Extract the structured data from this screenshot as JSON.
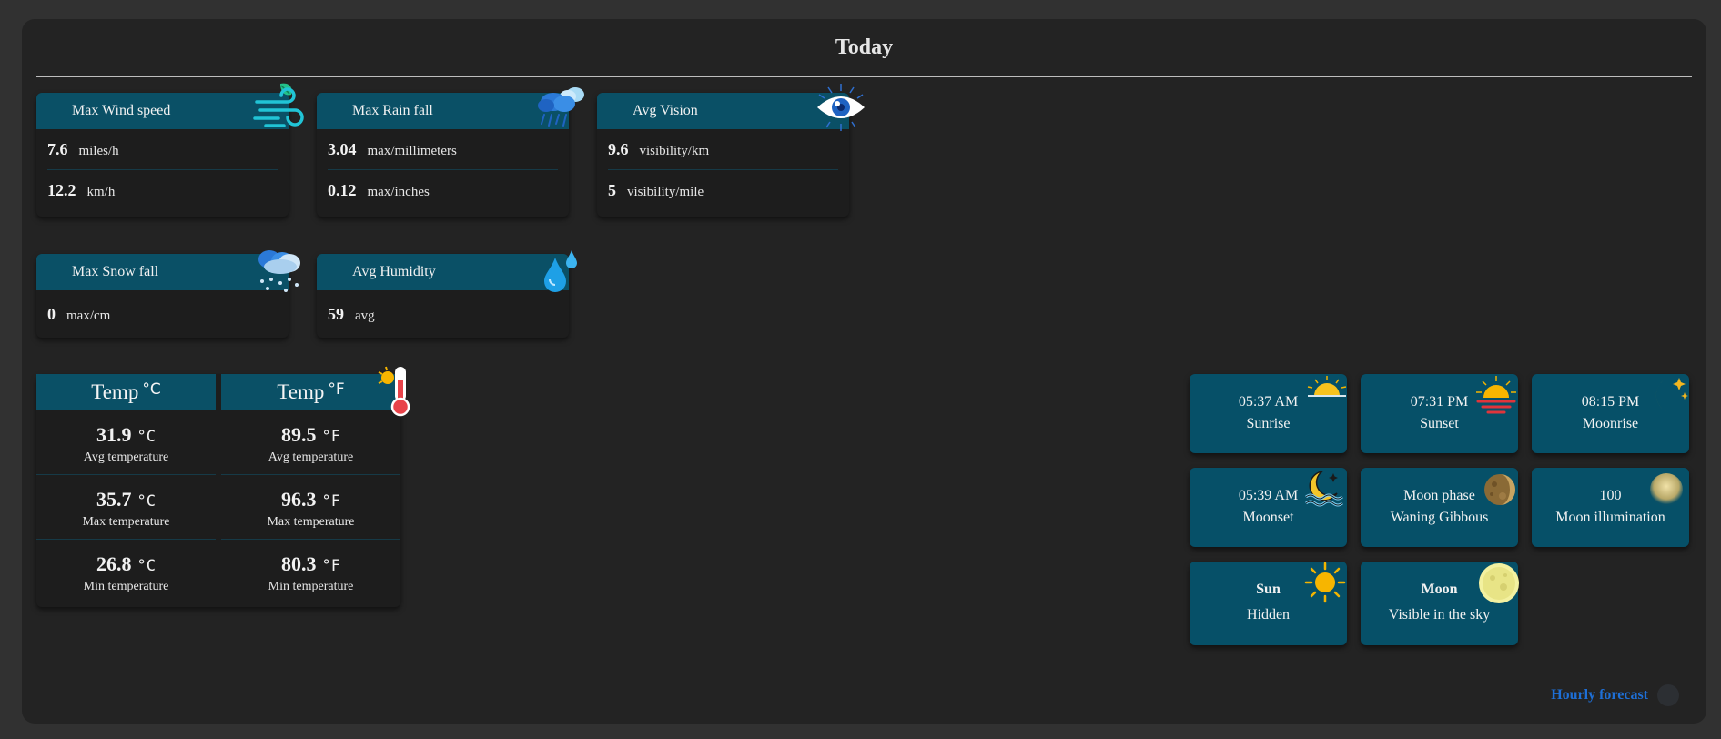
{
  "title": "Today",
  "wind": {
    "label": "Max Wind speed",
    "rows": [
      {
        "value": "7.6",
        "unit": "miles/h"
      },
      {
        "value": "12.2",
        "unit": "km/h"
      }
    ],
    "icon": "wind-icon"
  },
  "rain": {
    "label": "Max Rain fall",
    "rows": [
      {
        "value": "3.04",
        "unit": "max/millimeters"
      },
      {
        "value": "0.12",
        "unit": "max/inches"
      }
    ],
    "icon": "rain-cloud-icon"
  },
  "vision": {
    "label": "Avg Vision",
    "rows": [
      {
        "value": "9.6",
        "unit": "visibility/km"
      },
      {
        "value": "5",
        "unit": "visibility/mile"
      }
    ],
    "icon": "eye-icon"
  },
  "snow": {
    "label": "Max Snow fall",
    "rows": [
      {
        "value": "0",
        "unit": "max/cm"
      }
    ],
    "icon": "snow-cloud-icon"
  },
  "humidity": {
    "label": "Avg Humidity",
    "rows": [
      {
        "value": "59",
        "unit": "avg"
      }
    ],
    "icon": "water-drops-icon"
  },
  "temp": {
    "icon": "thermometer-sun-icon",
    "c": {
      "label": "Temp",
      "unit_head": "°C",
      "unit": "°C",
      "rows": [
        {
          "value": "31.9",
          "label": "Avg temperature"
        },
        {
          "value": "35.7",
          "label": "Max temperature"
        },
        {
          "value": "26.8",
          "label": "Min temperature"
        }
      ]
    },
    "f": {
      "label": "Temp",
      "unit_head": "°F",
      "unit": "°F",
      "rows": [
        {
          "value": "89.5",
          "label": "Avg temperature"
        },
        {
          "value": "96.3",
          "label": "Max temperature"
        },
        {
          "value": "80.3",
          "label": "Min temperature"
        }
      ]
    }
  },
  "astro": {
    "sunrise": {
      "time": "05:37 AM",
      "label": "Sunrise",
      "icon": "sunrise-icon"
    },
    "sunset": {
      "time": "07:31 PM",
      "label": "Sunset",
      "icon": "sunset-icon"
    },
    "moonrise": {
      "time": "08:15 PM",
      "label": "Moonrise",
      "icon": "crescent-moon-stars-icon"
    },
    "moonset": {
      "time": "05:39 AM",
      "label": "Moonset",
      "icon": "moonset-icon"
    },
    "moon_phase": {
      "title": "Moon phase",
      "value": "Waning Gibbous",
      "icon": "moon-phase-icon"
    },
    "moon_illumination": {
      "value": "100",
      "label": "Moon illumination",
      "icon": "moon-illumination-icon"
    },
    "sun": {
      "title": "Sun",
      "value": "Hidden",
      "icon": "sun-icon"
    },
    "moon": {
      "title": "Moon",
      "value": "Visible in the sky",
      "icon": "full-moon-icon"
    }
  },
  "hourly_link": "Hourly forecast",
  "colors": {
    "card_header": "#0a5066",
    "astro_card": "#065068",
    "link": "#1e6fd6",
    "panel": "#232323",
    "page": "#313131"
  }
}
